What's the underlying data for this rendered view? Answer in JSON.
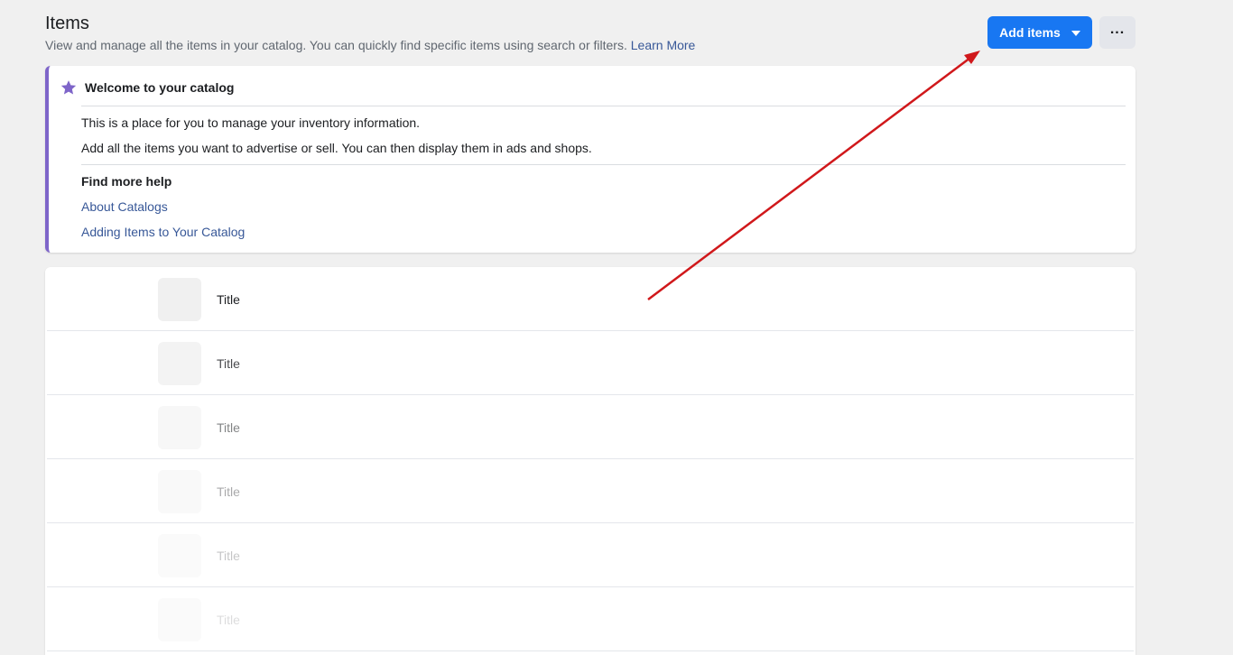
{
  "header": {
    "title": "Items",
    "subtitle": "View and manage all the items in your catalog. You can quickly find specific items using search or filters.",
    "learn_more": "Learn More"
  },
  "actions": {
    "add_items_label": "Add items",
    "more_label": "..."
  },
  "welcome": {
    "icon": "star-icon",
    "title": "Welcome to your catalog",
    "line1": "This is a place for you to manage your inventory information.",
    "line2": "Add all the items you want to advertise or sell. You can then display them in ads and shops.",
    "help_title": "Find more help",
    "links": [
      "About Catalogs",
      "Adding Items to Your Catalog"
    ]
  },
  "items": {
    "rows": [
      {
        "title": "Title",
        "fade": 1.0
      },
      {
        "title": "Title",
        "fade": 0.8
      },
      {
        "title": "Title",
        "fade": 0.55
      },
      {
        "title": "Title",
        "fade": 0.38
      },
      {
        "title": "Title",
        "fade": 0.25
      },
      {
        "title": "Title",
        "fade": 0.15
      }
    ]
  },
  "colors": {
    "primary": "#1877f2",
    "link": "#385898",
    "accent_border": "#7e65c9",
    "annotation_arrow": "#d0181b"
  }
}
